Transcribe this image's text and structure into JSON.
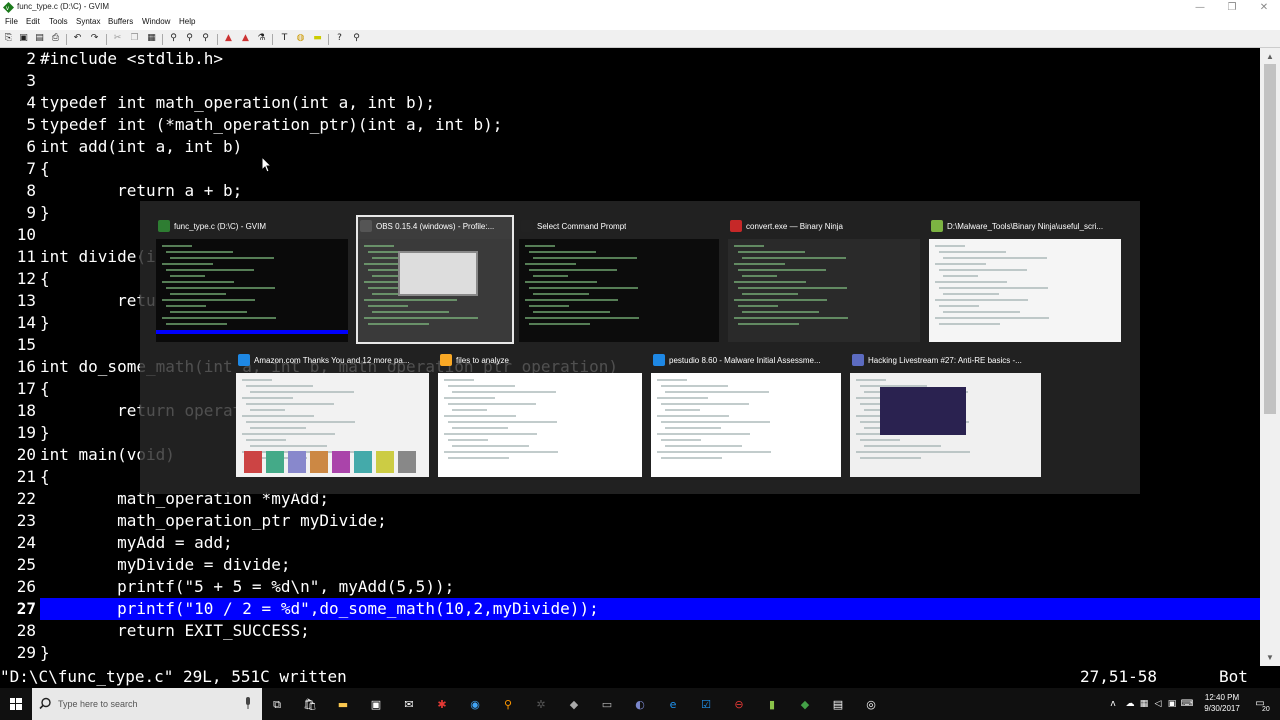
{
  "window": {
    "title": "func_type.c (D:\\C) - GVIM",
    "controls": [
      "—",
      "❐",
      "✕"
    ]
  },
  "menu": [
    "File",
    "Edit",
    "Tools",
    "Syntax",
    "Buffers",
    "Window",
    "Help"
  ],
  "editor": {
    "lines": [
      {
        "n": "2",
        "code": "#include <stdlib.h>"
      },
      {
        "n": "3",
        "code": ""
      },
      {
        "n": "4",
        "code": "typedef int math_operation(int a, int b);"
      },
      {
        "n": "5",
        "code": "typedef int (*math_operation_ptr)(int a, int b);"
      },
      {
        "n": "6",
        "code": "int add(int a, int b)"
      },
      {
        "n": "7",
        "code": "{"
      },
      {
        "n": "8",
        "code": "        return a + b;"
      },
      {
        "n": "9",
        "code": "}"
      },
      {
        "n": "10",
        "code": ""
      },
      {
        "n": "11",
        "code": "int divide(int a, int b)"
      },
      {
        "n": "12",
        "code": "{"
      },
      {
        "n": "13",
        "code": "        return a / b;"
      },
      {
        "n": "14",
        "code": "}"
      },
      {
        "n": "15",
        "code": ""
      },
      {
        "n": "16",
        "code": "int do_some_math(int a, int b, math_operation_ptr operation)"
      },
      {
        "n": "17",
        "code": "{"
      },
      {
        "n": "18",
        "code": "        return operation(a, b);"
      },
      {
        "n": "19",
        "code": "}"
      },
      {
        "n": "20",
        "code": "int main(void)"
      },
      {
        "n": "21",
        "code": "{"
      },
      {
        "n": "22",
        "code": "        math_operation *myAdd;"
      },
      {
        "n": "23",
        "code": "        math_operation_ptr myDivide;"
      },
      {
        "n": "24",
        "code": "        myAdd = add;"
      },
      {
        "n": "25",
        "code": "        myDivide = divide;"
      },
      {
        "n": "26",
        "code": "        printf(\"5 + 5 = %d\\n\", myAdd(5,5));"
      },
      {
        "n": "27",
        "code": "        printf(\"10 / 2 = %d\",do_some_math(10,2,myDivide));",
        "current": true
      },
      {
        "n": "28",
        "code": "        return EXIT_SUCCESS;"
      },
      {
        "n": "29",
        "code": "}"
      }
    ]
  },
  "status": {
    "message": "\"D:\\C\\func_type.c\" 29L, 551C written",
    "position": "27,51-58",
    "scroll": "Bot"
  },
  "switcher": {
    "row1": [
      {
        "title": "func_type.c (D:\\C) - GVIM",
        "icon": "gvim-icon",
        "color": "#2e7d32"
      },
      {
        "title": "OBS 0.15.4 (windows) - Profile:...",
        "icon": "obs-icon",
        "color": "#555555",
        "selected": true
      },
      {
        "title": "Select Command Prompt",
        "icon": "cmd-icon",
        "color": "#222222"
      },
      {
        "title": "convert.exe — Binary Ninja",
        "icon": "binja-icon",
        "color": "#c62828"
      },
      {
        "title": "D:\\Malware_Tools\\Binary Ninja\\useful_scri...",
        "icon": "notepadpp-icon",
        "color": "#7cb342"
      }
    ],
    "row2": [
      {
        "title": "Amazon.com Thanks You and 12 more pa...",
        "icon": "edge-icon",
        "color": "#1e88e5"
      },
      {
        "title": "files to analyze",
        "icon": "folder-icon",
        "color": "#f9a825"
      },
      {
        "title": "pestudio 8.60 - Malware Initial Assessme...",
        "icon": "pestudio-icon",
        "color": "#1e88e5"
      },
      {
        "title": "Hacking Livestream #27: Anti-RE basics -...",
        "icon": "firefox-icon",
        "color": "#5c6bc0"
      }
    ]
  },
  "taskbar": {
    "search_placeholder": "Type here to search",
    "time": "12:40 PM",
    "date": "9/30/2017",
    "notification_count": "20"
  }
}
